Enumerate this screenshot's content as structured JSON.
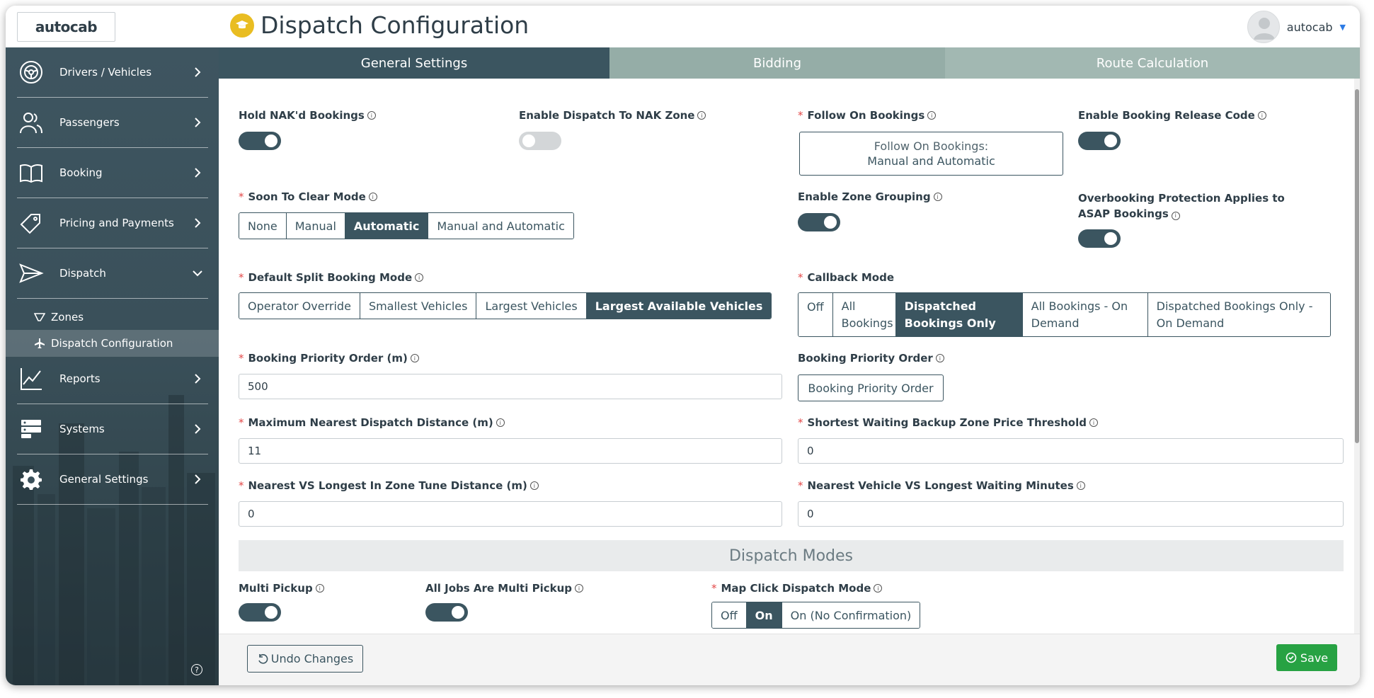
{
  "app": {
    "logo_text": "autocab",
    "page_title": "Dispatch Configuration",
    "user_name": "autocab"
  },
  "sidebar": {
    "items": [
      {
        "label": "Drivers / Vehicles",
        "icon": "steering-wheel-icon"
      },
      {
        "label": "Passengers",
        "icon": "people-icon"
      },
      {
        "label": "Booking",
        "icon": "book-icon"
      },
      {
        "label": "Pricing and Payments",
        "icon": "price-tag-icon"
      },
      {
        "label": "Dispatch",
        "icon": "send-icon"
      },
      {
        "label": "Reports",
        "icon": "chart-line-icon"
      },
      {
        "label": "Systems",
        "icon": "server-icon"
      },
      {
        "label": "General Settings",
        "icon": "gear-icon"
      }
    ],
    "sub_items": [
      {
        "label": "Zones",
        "icon": "zone-icon"
      },
      {
        "label": "Dispatch Configuration",
        "icon": "plane-icon"
      }
    ]
  },
  "tabs": [
    "General Settings",
    "Bidding",
    "Route Calculation"
  ],
  "fields": {
    "hold_naked": {
      "label": "Hold NAK'd Bookings",
      "enabled": true
    },
    "enable_dispatch_nak": {
      "label": "Enable Dispatch To NAK Zone",
      "enabled": false
    },
    "follow_on": {
      "label": "Follow On Bookings",
      "line1": "Follow On Bookings:",
      "line2": "Manual and Automatic"
    },
    "booking_release": {
      "label": "Enable Booking Release Code",
      "enabled": true
    },
    "soon_to_clear": {
      "label": "Soon To Clear Mode",
      "options": [
        "None",
        "Manual",
        "Automatic",
        "Manual and Automatic"
      ],
      "selected": "Automatic"
    },
    "zone_grouping": {
      "label": "Enable Zone Grouping",
      "enabled": true
    },
    "overbooking": {
      "label": "Overbooking Protection Applies to ASAP Bookings",
      "enabled": true
    },
    "split_booking": {
      "label": "Default Split Booking Mode",
      "options": [
        "Operator Override",
        "Smallest Vehicles",
        "Largest Vehicles",
        "Largest Available Vehicles"
      ],
      "selected": "Largest Available Vehicles"
    },
    "callback_mode": {
      "label": "Callback Mode",
      "options": [
        "Off",
        "All Bookings",
        "Dispatched Bookings Only",
        "All Bookings - On Demand",
        "Dispatched Bookings Only - On Demand"
      ],
      "selected": "Dispatched Bookings Only"
    },
    "priority_order_m": {
      "label": "Booking Priority Order (m)",
      "value": "500"
    },
    "priority_order": {
      "label": "Booking Priority Order",
      "button": "Booking Priority Order"
    },
    "max_nearest": {
      "label": "Maximum Nearest Dispatch Distance (m)",
      "value": "11"
    },
    "shortest_waiting": {
      "label": "Shortest Waiting Backup Zone Price Threshold",
      "value": "0"
    },
    "nearest_vs_longest": {
      "label": "Nearest VS Longest In Zone Tune Distance (m)",
      "value": "0"
    },
    "nearest_vehicle": {
      "label": "Nearest Vehicle VS Longest Waiting Minutes",
      "value": "0"
    },
    "section_dispatch_modes": "Dispatch Modes",
    "multi_pickup": {
      "label": "Multi Pickup",
      "enabled": true
    },
    "all_jobs_multi": {
      "label": "All Jobs Are Multi Pickup",
      "enabled": true
    },
    "map_click": {
      "label": "Map Click Dispatch Mode",
      "options": [
        "Off",
        "On",
        "On (No Confirmation)"
      ],
      "selected": "On"
    }
  },
  "footer": {
    "undo_label": "Undo Changes",
    "save_label": "Save"
  },
  "colors": {
    "accent": "#3b5560",
    "save": "#27a243",
    "required": "#e34848",
    "title_icon": "#e9bd22"
  }
}
